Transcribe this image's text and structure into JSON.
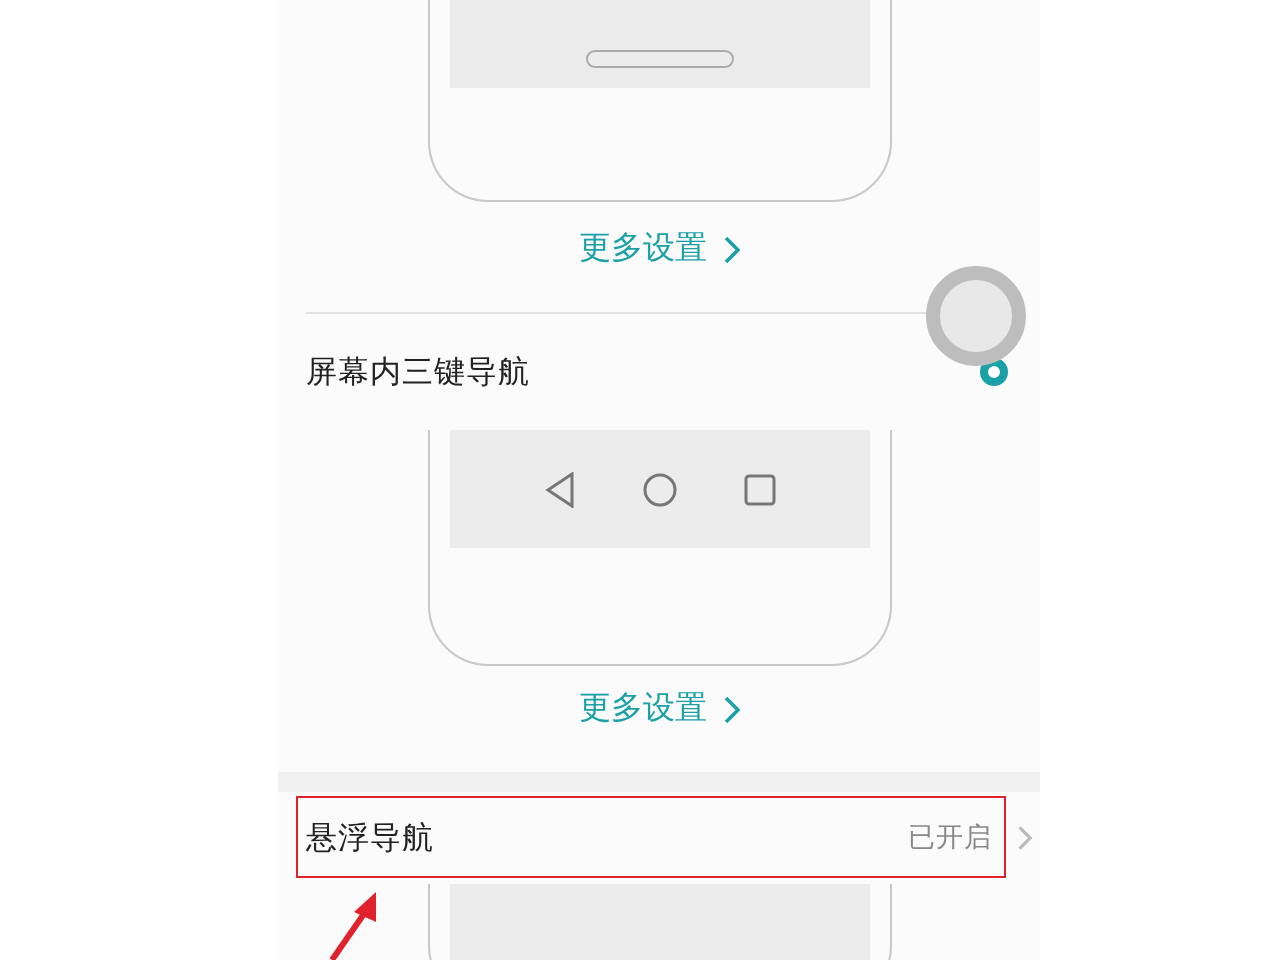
{
  "items": [
    {
      "kind": "gesture_preview",
      "link": "更多设置"
    },
    {
      "kind": "radio",
      "label": "屏幕内三键导航",
      "selected": true
    },
    {
      "kind": "three_key_preview",
      "link": "更多设置"
    },
    {
      "kind": "nav",
      "label": "悬浮导航",
      "value": "已开启",
      "highlighted": true
    },
    {
      "kind": "floating_preview"
    }
  ]
}
